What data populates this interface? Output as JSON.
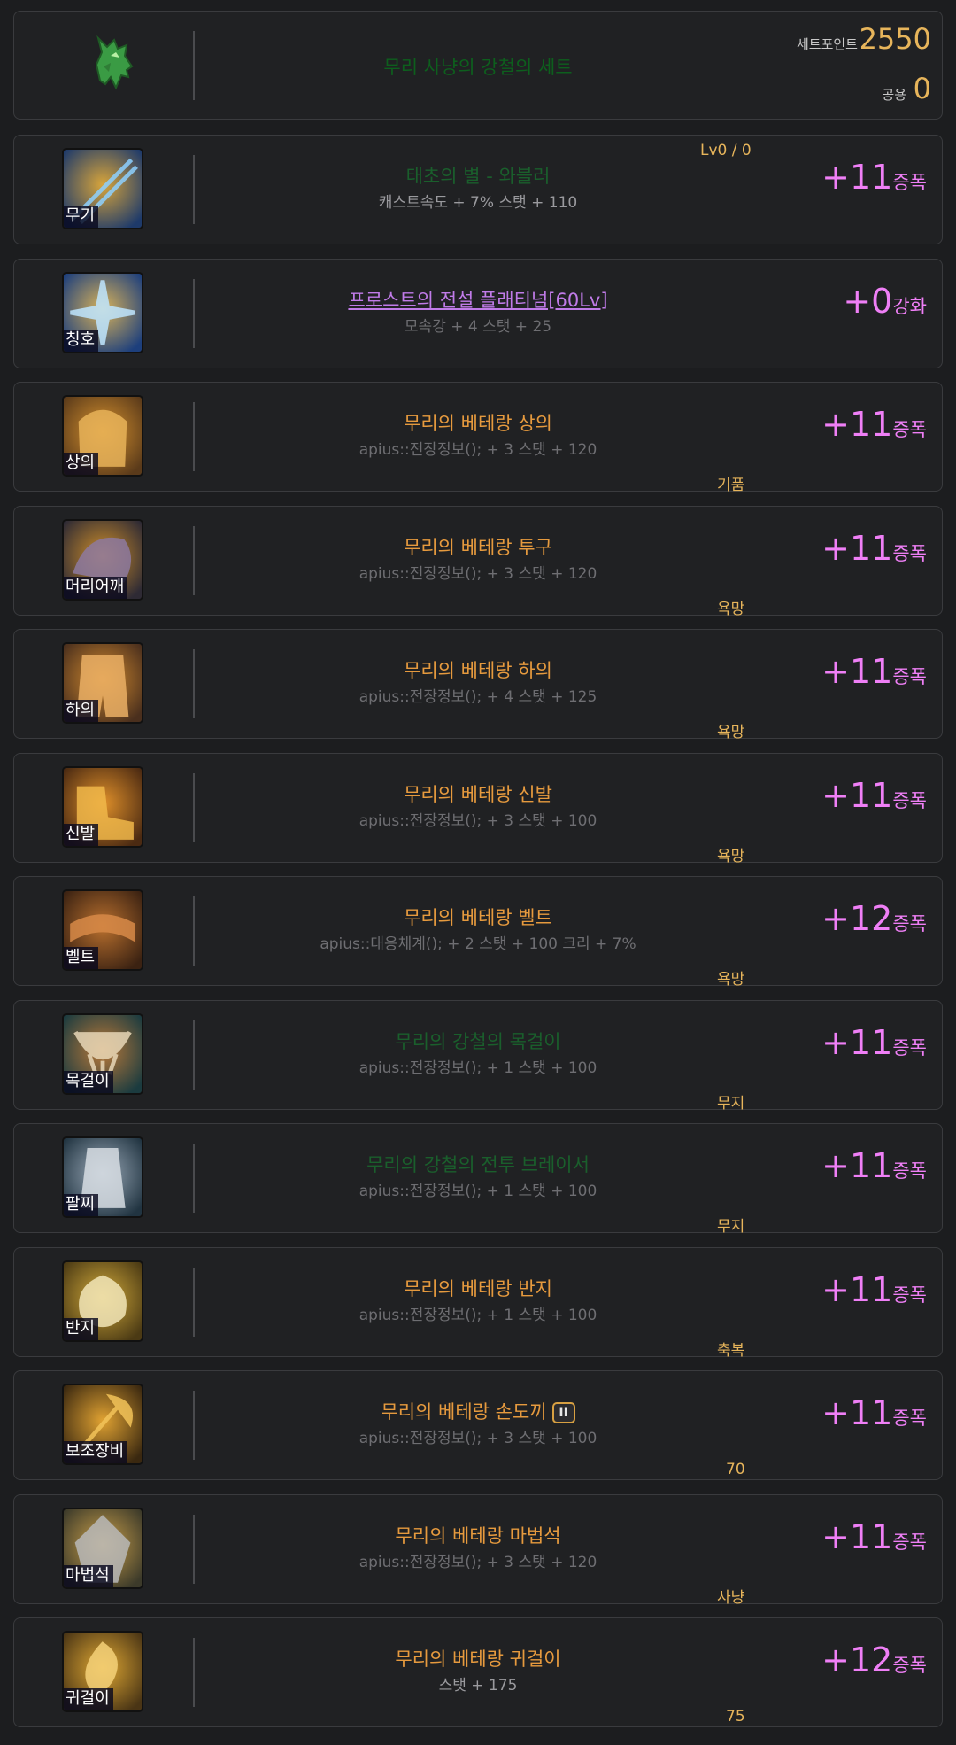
{
  "set": {
    "name": "무리 사냥의 강철의 세트",
    "set_point_label": "세트포인트",
    "set_point_value": "2550",
    "common_label": "공용",
    "common_value": "0"
  },
  "colors": {
    "background": "#1c1d1f",
    "card": "#202123",
    "card_border": "#3a3b3e",
    "item_name_orange": "#e69a3e",
    "item_name_green": "#1a5f2c",
    "title_purple": "#c07be8",
    "enhance_pink": "#ef7ff6",
    "gold": "#e7b55b",
    "stat_gray": "#6e6e72"
  },
  "items": [
    {
      "slot": "무기",
      "icon": "weapon-icon",
      "name": "태초의 별 - 와블러",
      "name_style": "green",
      "stats": "캐스트속도 + 7% 스탯 + 110",
      "stats_style": "light",
      "level": "Lv0 / 0",
      "note": "",
      "plus": "+11",
      "plus_label": "증폭"
    },
    {
      "slot": "칭호",
      "icon": "title-icon",
      "name": "프로스트의 전설 플래티넘[60Lv]",
      "name_style": "purple",
      "stats": "모속강 + 4 스탯 + 25",
      "stats_style": "",
      "note": "",
      "plus": "+0",
      "plus_label": "강화"
    },
    {
      "slot": "상의",
      "icon": "top-armor-icon",
      "name": "무리의 베테랑 상의",
      "stats": "apius::전장정보(); + 3 스탯 + 120",
      "note": "기품",
      "plus": "+11",
      "plus_label": "증폭"
    },
    {
      "slot": "머리어깨",
      "icon": "shoulder-icon",
      "name": "무리의 베테랑 투구",
      "stats": "apius::전장정보(); + 3 스탯 + 120",
      "note": "욕망",
      "plus": "+11",
      "plus_label": "증폭"
    },
    {
      "slot": "하의",
      "icon": "pants-icon",
      "name": "무리의 베테랑 하의",
      "stats": "apius::전장정보(); + 4 스탯 + 125",
      "note": "욕망",
      "plus": "+11",
      "plus_label": "증폭"
    },
    {
      "slot": "신발",
      "icon": "shoes-icon",
      "name": "무리의 베테랑 신발",
      "stats": "apius::전장정보(); + 3 스탯 + 100",
      "note": "욕망",
      "plus": "+11",
      "plus_label": "증폭"
    },
    {
      "slot": "벨트",
      "icon": "belt-icon",
      "name": "무리의 베테랑 벨트",
      "stats": "apius::대응체계(); + 2 스탯 + 100 크리 + 7%",
      "note": "욕망",
      "plus": "+12",
      "plus_label": "증폭"
    },
    {
      "slot": "목걸이",
      "icon": "necklace-icon",
      "name": "무리의 강철의 목걸이",
      "name_style": "green",
      "stats": "apius::전장정보(); + 1 스탯 + 100",
      "note": "무지",
      "plus": "+11",
      "plus_label": "증폭"
    },
    {
      "slot": "팔찌",
      "icon": "bracelet-icon",
      "name": "무리의 강철의 전투 브레이서",
      "name_style": "green",
      "stats": "apius::전장정보(); + 1 스탯 + 100",
      "note": "무지",
      "plus": "+11",
      "plus_label": "증폭"
    },
    {
      "slot": "반지",
      "icon": "ring-icon",
      "name": "무리의 베테랑 반지",
      "stats": "apius::전장정보(); + 1 스탯 + 100",
      "note": "축복",
      "plus": "+11",
      "plus_label": "증폭"
    },
    {
      "slot": "보조장비",
      "icon": "sub-equipment-icon",
      "name": "무리의 베테랑 손도끼",
      "badge": "II",
      "stats": "apius::전장정보(); + 3 스탯 + 100",
      "note": "70",
      "plus": "+11",
      "plus_label": "증폭"
    },
    {
      "slot": "마법석",
      "icon": "magic-stone-icon",
      "name": "무리의 베테랑 마법석",
      "stats": "apius::전장정보(); + 3 스탯 + 120",
      "note": "사냥",
      "plus": "+11",
      "plus_label": "증폭"
    },
    {
      "slot": "귀걸이",
      "icon": "earring-icon",
      "name": "무리의 베테랑 귀걸이",
      "stats": "스탯 + 175",
      "stats_style": "light",
      "note": "75",
      "plus": "+12",
      "plus_label": "증폭"
    }
  ]
}
